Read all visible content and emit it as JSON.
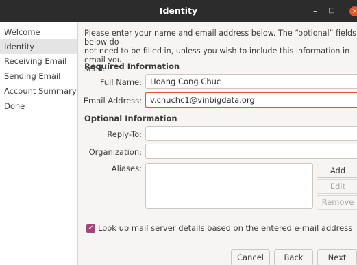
{
  "window": {
    "title": "Identity",
    "minimize_glyph": "–",
    "maximize_glyph": "□",
    "close_glyph": "×"
  },
  "sidebar": {
    "items": [
      {
        "label": "Welcome"
      },
      {
        "label": "Identity"
      },
      {
        "label": "Receiving Email"
      },
      {
        "label": "Sending Email"
      },
      {
        "label": "Account Summary"
      },
      {
        "label": "Done"
      }
    ],
    "selected": "Identity"
  },
  "main": {
    "intro": "Please enter your name and email address below. The “optional” fields below do\nnot need to be filled in, unless you wish to include this information in email you\nsend.",
    "required_heading": "Required Information",
    "full_name_label": "Full Name:",
    "full_name_value": "Hoang Cong Chuc",
    "email_label": "Email Address:",
    "email_value": "v.chuchc1@vinbigdata.org",
    "optional_heading": "Optional Information",
    "reply_to_label": "Reply-To:",
    "reply_to_value": "",
    "organization_label": "Organization:",
    "organization_value": "",
    "aliases_label": "Aliases:",
    "add_label": "Add",
    "edit_label": "Edit",
    "remove_label": "Remove",
    "lookup_label": "Look up mail server details based on the entered e-mail address",
    "lookup_checked": true,
    "check_glyph": "✓"
  },
  "footer": {
    "cancel_label": "Cancel",
    "back_label": "Back",
    "next_label": "Next"
  },
  "colors": {
    "titlebar": "#2c2c2c",
    "accent_orange": "#e95420",
    "checkbox": "#a5437b",
    "selected_row": "#e4e4e4"
  },
  "icons": [
    "minimize-icon",
    "maximize-icon",
    "close-icon",
    "checkmark-icon"
  ]
}
